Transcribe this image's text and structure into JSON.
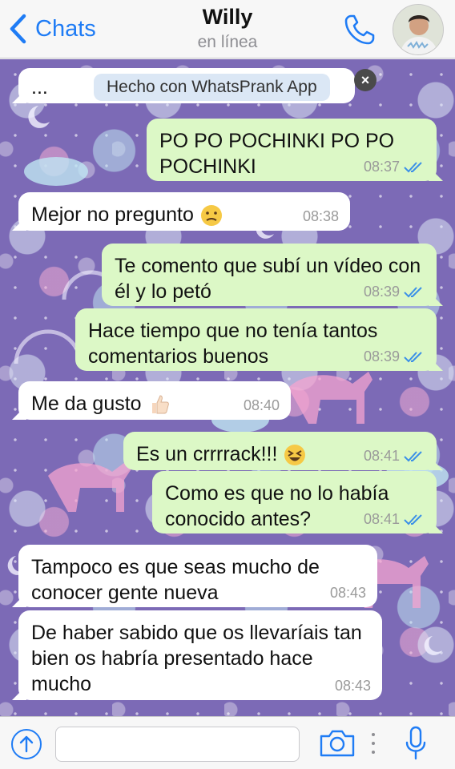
{
  "header": {
    "back_label": "Chats",
    "contact_name": "Willy",
    "status": "en línea"
  },
  "prank_banner": {
    "ellipsis": "...",
    "text": "Hecho con WhatsPrank App",
    "close_symbol": "×"
  },
  "messages": [
    {
      "direction": "out",
      "text": "PO PO POCHINKI PO PO POCHINKI",
      "time": "08:37",
      "read": true
    },
    {
      "direction": "in",
      "text": "Mejor no pregunto",
      "emoji": "confused-face",
      "time": "08:38"
    },
    {
      "direction": "out",
      "text": "Te comento que subí un vídeo con él y lo petó",
      "time": "08:39",
      "read": true
    },
    {
      "direction": "out",
      "text": "Hace tiempo que no tenía tantos comentarios buenos",
      "time": "08:39",
      "read": true
    },
    {
      "direction": "in",
      "text": "Me da gusto",
      "emoji": "thumbs-up",
      "time": "08:40"
    },
    {
      "direction": "out",
      "text": "Es un crrrrack!!!",
      "emoji": "laughing-face",
      "time": "08:41",
      "read": true
    },
    {
      "direction": "out",
      "text": "Como es que no lo había conocido antes?",
      "time": "08:41",
      "read": true
    },
    {
      "direction": "in",
      "text": "Tampoco es que seas mucho de conocer gente nueva",
      "time": "08:43"
    },
    {
      "direction": "in",
      "text": "De haber sabido que os llevaríais tan bien os habría presentado hace mucho",
      "time": "08:43"
    }
  ],
  "input": {
    "placeholder": ""
  },
  "colors": {
    "accent": "#1f7cf5",
    "outgoing_bubble": "#dcf8c6",
    "incoming_bubble": "#ffffff",
    "read_ticks": "#3a8fe8"
  }
}
